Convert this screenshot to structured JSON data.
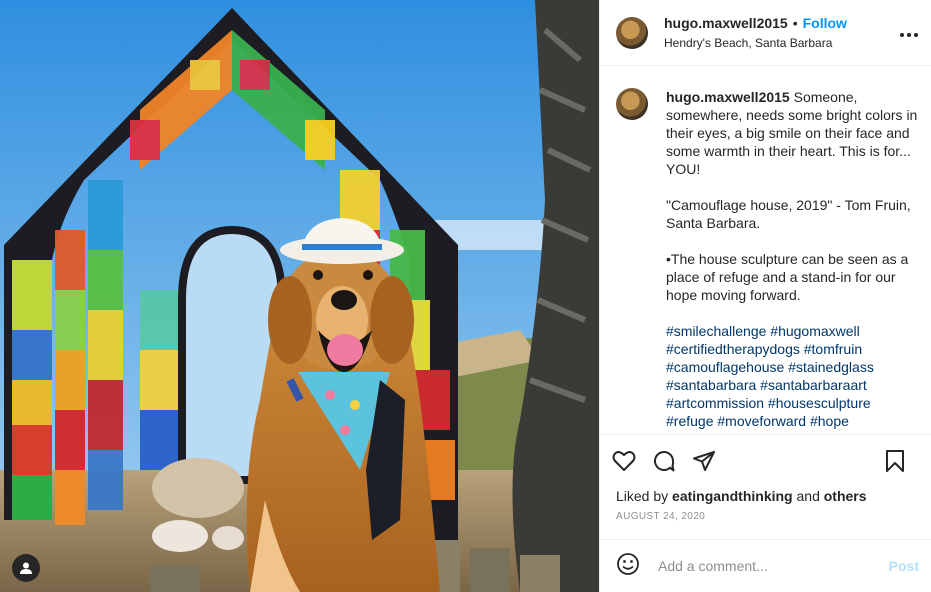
{
  "post": {
    "username": "hugo.maxwell2015",
    "separator": "•",
    "follow_label": "Follow",
    "location": "Hendry's Beach, Santa Barbara",
    "more_icon": "more-horizontal-icon"
  },
  "caption": {
    "username": "hugo.maxwell2015",
    "text": "Someone, somewhere, needs some bright colors in their eyes, a big smile on their face and some warmth in their heart. This is for... YOU!\n\n\"Camouflage house, 2019\" - Tom Fruin, Santa Barbara.\n\n•The house sculpture can be seen as a place of refuge and a stand-in for our hope moving forward.\n\n",
    "hashtags": "#smilechallenge #hugomaxwell #certifiedtherapydogs #tomfruin #camouflagehouse #stainedglass #santabarbara #santabarbaraart #artcommission #housesculpture #refuge #moveforward #hope #mondaymotivation"
  },
  "actions": {
    "like_icon": "heart-icon",
    "comment_icon": "comment-icon",
    "share_icon": "share-icon",
    "save_icon": "bookmark-icon"
  },
  "likes": {
    "prefix": "Liked by",
    "user": "eatingandthinking",
    "connector": "and",
    "others": "others"
  },
  "date": "August 24, 2020",
  "comment": {
    "placeholder": "Add a comment...",
    "post_label": "Post",
    "emoji_icon": "emoji-icon"
  },
  "photo": {
    "tag_icon": "user-tag-icon"
  }
}
